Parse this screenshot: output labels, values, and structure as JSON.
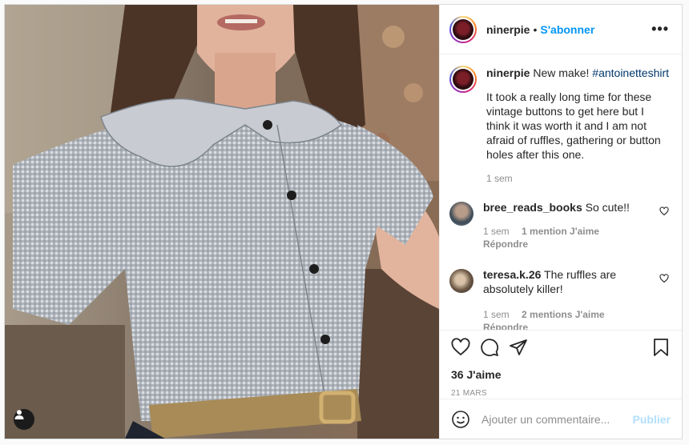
{
  "post": {
    "username": "ninerpie",
    "dot": "•",
    "follow_label": "S'abonner",
    "more_label": "•••",
    "caption": {
      "username": "ninerpie",
      "text": "New make!",
      "hashtag": "#antoinetteshirt",
      "body": "It took a really long time for these vintage buttons to get here but I think it was worth it and I am not afraid of ruffles, gathering or button holes after this one.",
      "time": "1 sem"
    },
    "comments": [
      {
        "username": "bree_reads_books",
        "text": "So cute!!",
        "time": "1 sem",
        "likes": "1 mention J'aime",
        "reply": "Répondre"
      },
      {
        "username": "teresa.k.26",
        "text": "The ruffles are absolutely killer!",
        "time": "1 sem",
        "likes": "2 mentions J'aime",
        "reply": "Répondre"
      }
    ],
    "likes": "36 J'aime",
    "date": "21 MARS",
    "add_comment": {
      "placeholder": "Ajouter un commentaire...",
      "publish_label": "Publier"
    }
  },
  "colors": {
    "accent": "#0095f6",
    "muted": "#8e8e8e",
    "publish_disabled": "#b2dffc",
    "border": "#dbdbdb"
  },
  "icons": [
    "user-tag-icon",
    "more-options-icon",
    "heart-icon",
    "comment-icon",
    "share-icon",
    "bookmark-icon",
    "emoji-icon"
  ]
}
